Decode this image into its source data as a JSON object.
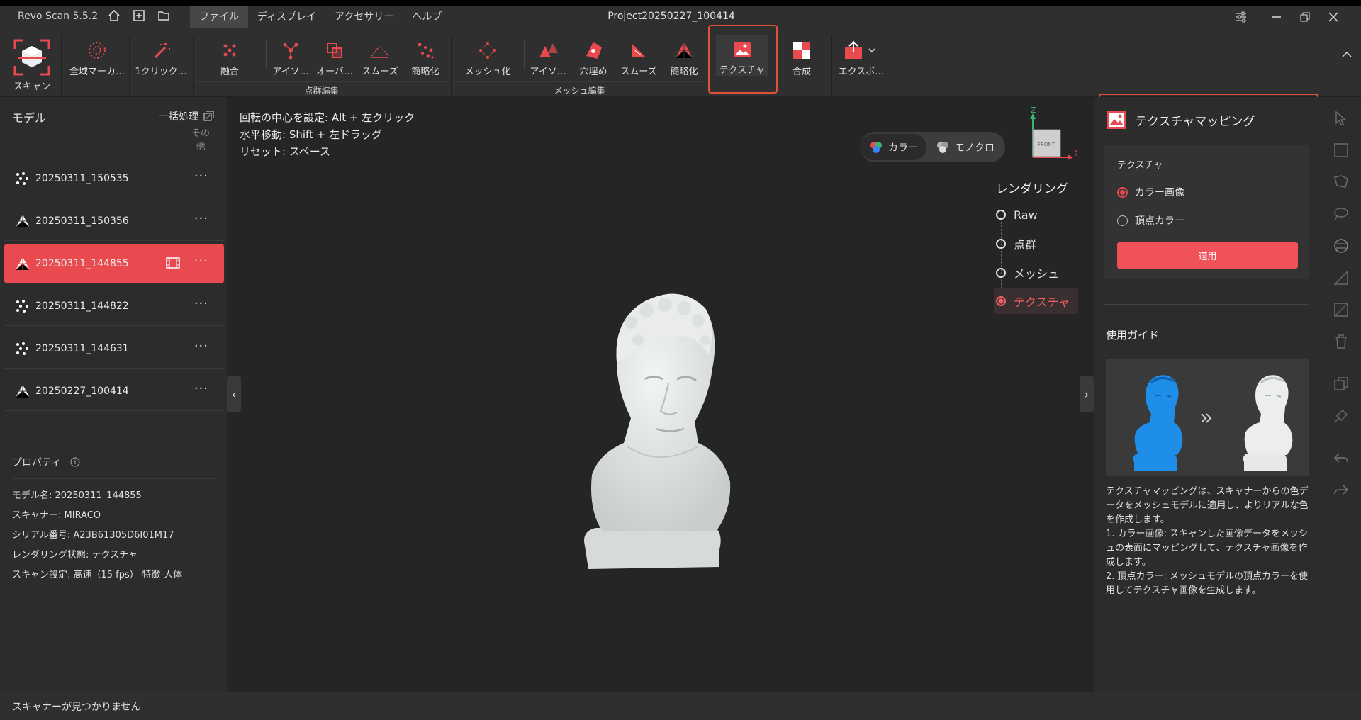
{
  "app": {
    "name": "Revo Scan 5.5.2",
    "project": "Project20250227_100414"
  },
  "menu": [
    {
      "label": "ファイル",
      "active": true
    },
    {
      "label": "ディスプレイ"
    },
    {
      "label": "アクセサリー"
    },
    {
      "label": "ヘルプ"
    }
  ],
  "toolbar": {
    "scan": "スキャン",
    "global_marker": "全域マーカ…",
    "one_click": "1クリック…",
    "pc_tools": [
      "融合",
      "アイソ…",
      "オーバ…",
      "スムーズ",
      "簡略化"
    ],
    "pc_group": "点群編集",
    "mesh_tools": [
      "メッシュ化",
      "アイソ…",
      "穴埋め",
      "スムーズ",
      "簡略化"
    ],
    "mesh_group": "メッシュ編集",
    "texture": "テクスチャ",
    "merge": "合成",
    "export": "エクスポ…"
  },
  "left": {
    "title": "モデル",
    "batch": "一括処理",
    "other": "その他",
    "models": [
      {
        "name": "20250311_150535",
        "type": "pointcloud"
      },
      {
        "name": "20250311_150356",
        "type": "mesh"
      },
      {
        "name": "20250311_144855",
        "type": "mesh",
        "selected": true
      },
      {
        "name": "20250311_144822",
        "type": "pointcloud"
      },
      {
        "name": "20250311_144631",
        "type": "pointcloud"
      },
      {
        "name": "20250227_100414",
        "type": "mesh"
      }
    ],
    "props_title": "プロパティ",
    "props": [
      "モデル名: 20250311_144855",
      "スキャナー: MIRACO",
      "シリアル番号: A23B61305D6I01M17",
      "レンダリング状態: テクスチャ",
      "スキャン設定: 高速（15 fps）-特徴-人体"
    ]
  },
  "viewport": {
    "hints": [
      "回転の中心を設定: Alt + 左クリック",
      "水平移動: Shift + 左ドラッグ",
      "リセット: スペース"
    ],
    "color_toggle": [
      "カラー",
      "モノクロ"
    ],
    "rendering_title": "レンダリング",
    "rendering": [
      {
        "label": "Raw"
      },
      {
        "label": "点群"
      },
      {
        "label": "メッシュ"
      },
      {
        "label": "テクスチャ",
        "active": true
      }
    ],
    "axis": {
      "z": "Z",
      "x": "X",
      "front": "FRONT"
    }
  },
  "texture_panel": {
    "title": "テクスチャマッピング",
    "section": "テクスチャ",
    "options": [
      {
        "label": "カラー画像",
        "checked": true
      },
      {
        "label": "頂点カラー"
      }
    ],
    "apply": "適用",
    "guide_title": "使用ガイド",
    "guide_text": "テクスチャマッピングは、スキャナーからの色データをメッシュモデルに適用し、よりリアルな色を作成します。\n1. カラー画像: スキャンした画像データをメッシュの表面にマッピングして、テクスチャ画像を作成します。\n2. 頂点カラー: メッシュモデルの頂点カラーを使用してテクスチャ画像を生成します。"
  },
  "status": "スキャナーが見つかりません",
  "colors": {
    "accent": "#e84a4f",
    "annotation": "#e0513a"
  }
}
